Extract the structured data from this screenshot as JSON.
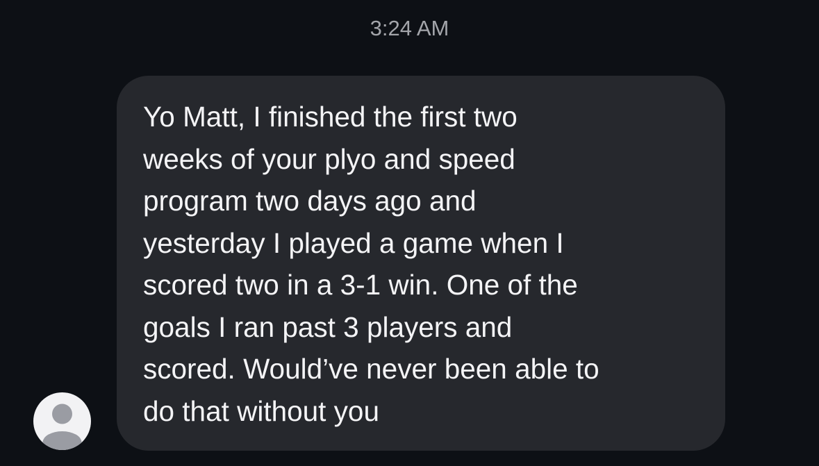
{
  "conversation": {
    "timestamp": "3:24 AM",
    "messages": [
      {
        "direction": "incoming",
        "text": "Yo Matt, I finished the first two\nweeks of your plyo and speed\nprogram two days ago and\nyesterday I played a game when I\nscored two in a 3-1 win. One of the\ngoals I ran past 3 players and\nscored. Would’ve never been able to\ndo that without you"
      }
    ],
    "sender_avatar": {
      "icon": "person-silhouette-icon"
    }
  },
  "colors": {
    "background": "#0d1015",
    "bubble": "#26282d",
    "bubble_text": "#f4f4f6",
    "timestamp_text": "#a3a5aa",
    "avatar_bg": "#f2f2f4",
    "avatar_figure": "#9a9ca3"
  }
}
